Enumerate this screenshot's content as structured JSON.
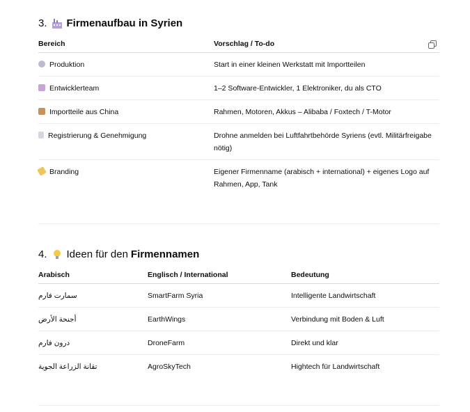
{
  "section3": {
    "number": "3.",
    "title": "Firmenaufbau in Syrien",
    "icon": "factory-emoji",
    "headers": [
      "Bereich",
      "Vorschlag / To-do"
    ],
    "rows": [
      {
        "icon": "gear-icon",
        "area": "Produktion",
        "proposal": "Start in einer kleinen Werkstatt mit Importteilen"
      },
      {
        "icon": "technologist-icon",
        "area": "Entwicklerteam",
        "proposal": "1–2 Software-Entwickler, 1 Elektroniker, du als CTO"
      },
      {
        "icon": "package-icon",
        "area": "Importteile aus China",
        "proposal": "Rahmen, Motoren, Akkus – Alibaba / Foxtech / T-Motor"
      },
      {
        "icon": "document-icon",
        "area": "Registrierung & Genehmigung",
        "proposal": "Drohne anmelden bei Luftfahrtbehörde Syriens (evtl. Militärfreigabe nötig)"
      },
      {
        "icon": "label-tag-icon",
        "area": "Branding",
        "proposal": "Eigener Firmenname (arabisch + international) + eigenes Logo auf Rahmen, App, Tank"
      }
    ]
  },
  "section4": {
    "number": "4.",
    "title_prefix": "Ideen für den",
    "title_bold": "Firmennamen",
    "icon": "light-bulb-emoji",
    "headers": [
      "Arabisch",
      "Englisch / International",
      "Bedeutung"
    ],
    "rows": [
      {
        "arabic": "سمارت فارم",
        "english": "SmartFarm Syria",
        "meaning": "Intelligente Landwirtschaft"
      },
      {
        "arabic": "أجنحة الأرض",
        "english": "EarthWings",
        "meaning": "Verbindung mit Boden & Luft"
      },
      {
        "arabic": "درون فارم",
        "english": "DroneFarm",
        "meaning": "Direkt und klar"
      },
      {
        "arabic": "تقانة الزراعة الجوية",
        "english": "AgroSkyTech",
        "meaning": "Hightech für Landwirtschaft"
      }
    ]
  },
  "colors": {
    "text": "#0d0d0d",
    "border": "#d9d9d9",
    "row_border": "#ececec"
  }
}
